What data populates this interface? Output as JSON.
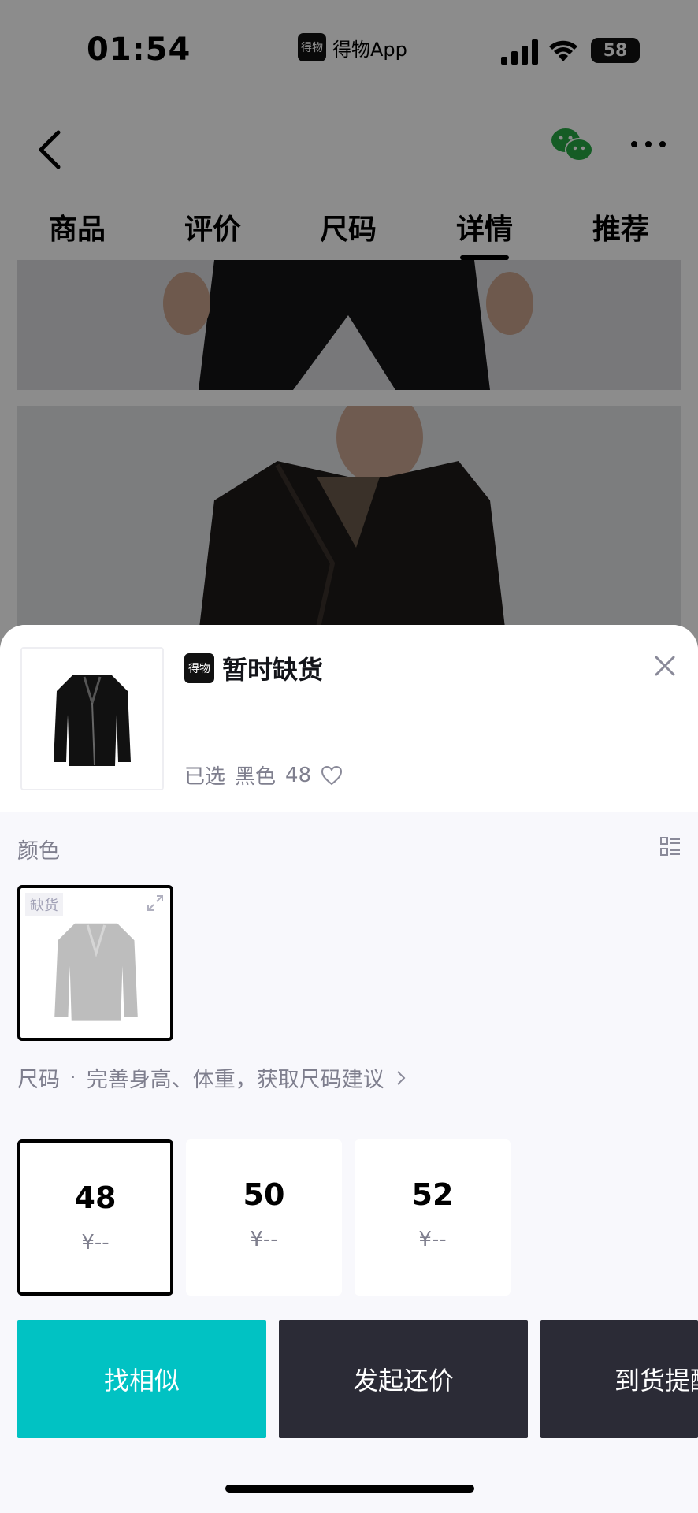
{
  "status_bar": {
    "time": "01:54",
    "app_name": "得物App",
    "app_logo_text": "得物",
    "battery": "58"
  },
  "nav": {
    "back_icon": "chevron-left-icon",
    "share_icon": "wechat-icon",
    "more_icon": "more-icon"
  },
  "tabs": [
    {
      "label": "商品"
    },
    {
      "label": "评价"
    },
    {
      "label": "尺码"
    },
    {
      "label": "详情",
      "active": true
    },
    {
      "label": "推荐"
    }
  ],
  "sheet": {
    "brand_logo_text": "得物",
    "stock_status": "暂时缺货",
    "selected_prefix": "已选",
    "selected_color": "黑色",
    "selected_size": "48",
    "color_section_label": "颜色",
    "color_options": [
      {
        "badge": "缺货",
        "selected": true
      }
    ],
    "size_section_label": "尺码",
    "size_hint": "完善身高、体重，获取尺码建议",
    "sizes": [
      {
        "size": "48",
        "price": "¥--",
        "selected": true
      },
      {
        "size": "50",
        "price": "¥--",
        "selected": false
      },
      {
        "size": "52",
        "price": "¥--",
        "selected": false
      }
    ]
  },
  "actions": {
    "find_similar": "找相似",
    "bargain": "发起还价",
    "notify": "到货提醒"
  },
  "colors": {
    "accent_teal": "#01c2c3",
    "dark_button": "#2b2b36",
    "muted_text": "#7f7f8e"
  }
}
